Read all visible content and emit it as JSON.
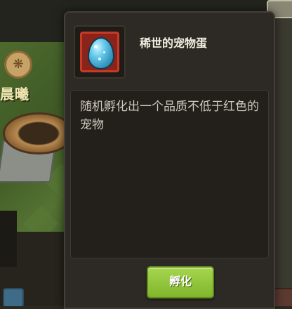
{
  "scene": {
    "time_of_day_label": "晨曦",
    "time_icon": "wheat-icon"
  },
  "item_popup": {
    "item_name": "稀世的宠物蛋",
    "item_icon": "pet-egg-icon",
    "rarity_color": "#c73a28",
    "description": "随机孵化出一个品质不低于红色的宠物",
    "hatch_button_label": "孵化",
    "hatch_button_color": "#8fc23a"
  }
}
